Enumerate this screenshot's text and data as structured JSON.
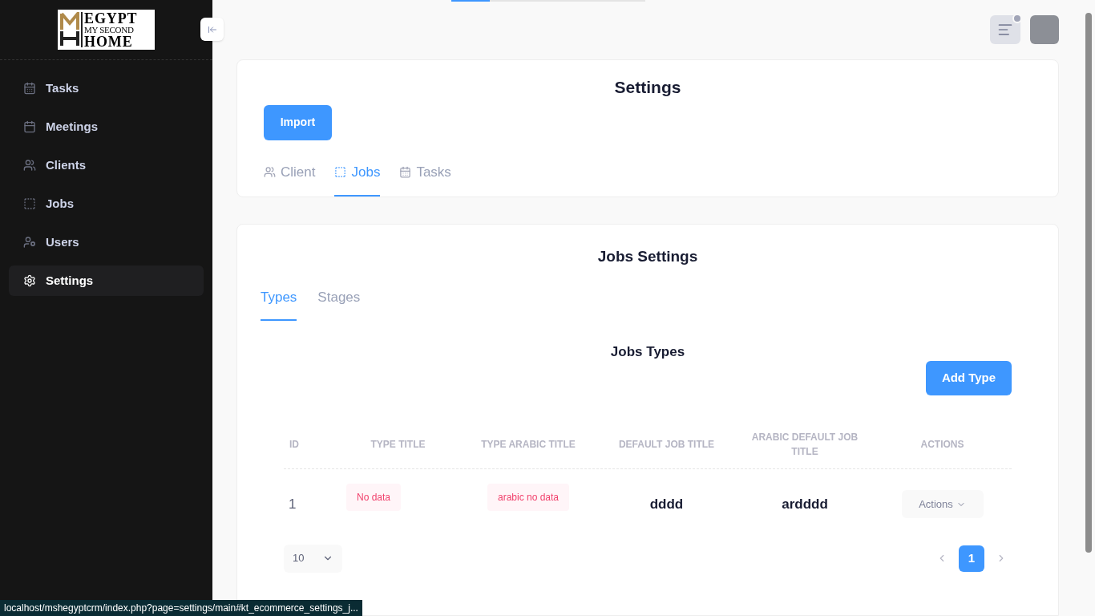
{
  "sidebar": {
    "logo": {
      "lines": [
        "EGYPT",
        "MY SECOND",
        "HOME"
      ]
    },
    "items": [
      {
        "label": "Tasks",
        "selected": false
      },
      {
        "label": "Meetings",
        "selected": false
      },
      {
        "label": "Clients",
        "selected": false
      },
      {
        "label": "Jobs",
        "selected": false
      },
      {
        "label": "Users",
        "selected": false
      },
      {
        "label": "Settings",
        "selected": true
      }
    ]
  },
  "loading_bar": {
    "level": 0.2
  },
  "header": {
    "notification_dot": true
  },
  "settings_card": {
    "title": "Settings",
    "import_button": "Import",
    "tabs": [
      {
        "label": "Client",
        "selected": false
      },
      {
        "label": "Jobs",
        "selected": true
      },
      {
        "label": "Tasks",
        "selected": false
      }
    ]
  },
  "jobs_card": {
    "title": "Jobs Settings",
    "tabs": [
      {
        "label": "Types",
        "selected": true
      },
      {
        "label": "Stages",
        "selected": false
      }
    ],
    "section_title": "Jobs Types",
    "add_button": "Add Type",
    "table": {
      "columns": [
        "ID",
        "TYPE TITLE",
        "TYPE ARABIC TITLE",
        "DEFAULT JOB TITLE",
        "ARABIC DEFAULT JOB TITLE",
        "ACTIONS"
      ],
      "rows": [
        {
          "id": "1",
          "type_title": "No data",
          "type_arabic_title": "arabic no data",
          "default_job_title": "dddd",
          "arabic_default_job_title": "ardddd",
          "actions": "Actions"
        }
      ]
    },
    "page_size": "10",
    "pages": [
      {
        "label": "1",
        "selected": true
      }
    ]
  },
  "status_bar": {
    "url": "localhost/mshegyptcrm/index.php?page=settings/main#kt_ecommerce_settings_j..."
  }
}
